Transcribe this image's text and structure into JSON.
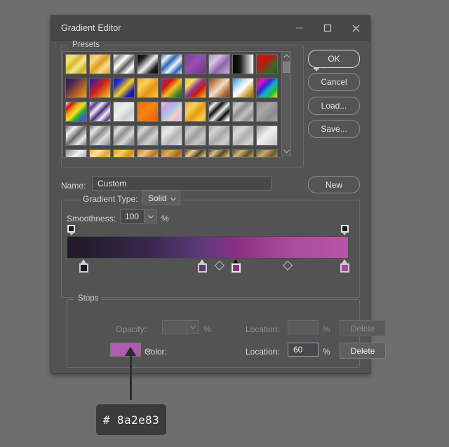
{
  "window": {
    "title": "Gradient Editor",
    "controls": [
      {
        "name": "minimize",
        "glyph": "minimize-icon"
      },
      {
        "name": "maximize",
        "glyph": "maximize-icon"
      },
      {
        "name": "close",
        "glyph": "close-icon"
      }
    ]
  },
  "presets": {
    "label": "Presets",
    "gear_icon": "gear-icon",
    "scrollbar": {
      "up": "chevron-up-icon",
      "down": "chevron-down-icon"
    },
    "swatches": [
      "linear-gradient(135deg,#e8d24a 0%,#f3e27a 22%,#d8b731 42%,#f5e98e 60%,#cfae2c 80%,#e6d456 100%)",
      "linear-gradient(135deg,#f0b93a 0%,#f7d684 24%,#e09b1c 48%,#f8dd92 70%,#dd9a1d 100%)",
      "linear-gradient(135deg,#ffffff 0%,#8d8d8d 18%,#ffffff 38%,#5e5e5e 58%,#ffffff 78%,#7a7a7a 100%)",
      "linear-gradient(135deg,#050505 0%,#1c1c1c 22%,#f2f2f2 52%,#202020 78%,#070707 100%)",
      "linear-gradient(135deg,#2f6fc4 0%,#e9eef6 20%,#2c66b8 40%,#eef2f8 60%,#2a63b4 80%,#e8eef6 100%)",
      "linear-gradient(135deg,#7a3c96 0%,#9a4fb4 45%,#6d3187 100%)",
      "linear-gradient(135deg,#b08ac8 0%,#d8c4e4 30%,#8e63ab 60%,#cdb5de 100%)",
      "linear-gradient(90deg,#000000 0%,#1a1a1a 35%,#ffffff 100%)",
      "linear-gradient(135deg,#d01313 0%,#b81b12 40%,#2f6b2c 75%,#1d5b22 100%)",
      "linear-gradient(135deg,#2b1b4d 0%,#4a2a55 28%,#b05d1e 62%,#f0a022 100%)",
      "linear-gradient(135deg,#1a1ab5 0%,#d01f1f 48%,#f2d21c 100%)",
      "linear-gradient(135deg,#1a1ab5 0%,#2e2ec0 22%,#f2d21c 52%,#1a1ab5 80%,#1313a0 100%)",
      "linear-gradient(135deg,#f0a81e 0%,#f7d25c 30%,#e89210 62%,#f6cc52 100%)",
      "linear-gradient(135deg,#7a3c96 0%,#d01313 30%,#f2c21c 55%,#2f7a2c 85%,#1d5b22 100%)",
      "linear-gradient(135deg,#f2c21c 0%,#f6dc6a 25%,#8a3b8a 48%,#d01313 66%,#f2c21c 100%)",
      "linear-gradient(135deg,#7a4a28 0%,#c98f5e 25%,#f3ddc9 50%,#b47a48 75%,#6e4022 100%)",
      "linear-gradient(135deg,#2f8fe0 0%,#bfe0f5 32%,#ffffff 50%,#c99a2a 78%,#8a6412 100%)",
      "linear-gradient(135deg,#d01313 0%,#e012c0 20%,#2a2ad0 40%,#16b0d0 58%,#22c02a 78%,#f2e21c 100%)",
      "linear-gradient(135deg,#e8e8e8 0%,#d01313 18%,#f2a21c 34%,#f2e21c 50%,#2ab02a 66%,#2a6ad0 82%,#a02ad0 100%)",
      "linear-gradient(135deg,#f0f0f0 0%,#5a3a8a 18%,#efeff5 34%,#4a2e7a 52%,#f0f0f5 70%,#5a3a8a 88%,#efeff5 100%)",
      "linear-gradient(135deg,#d9d9d9 0%,#eeeeee 40%,#cfcfcf 70%,#e8e8e8 100%)",
      "linear-gradient(135deg,#f06a08 0%,#f58416 45%,#e85f04 100%)",
      "linear-gradient(135deg,#f0c8d8 0%,#c8a0e0 22%,#a8c0ee 44%,#f0d0c0 66%,#e0b8e8 88%,#c8d8f0 100%)",
      "linear-gradient(135deg,#f0a81e 0%,#f8d35e 28%,#e89a10 56%,#f7cf58 84%,#eca11a 100%)",
      "linear-gradient(135deg,#080808 0%,#f2f2f2 18%,#0c0c0c 36%,#eeeeee 54%,#0a0a0a 72%,#f0f0f0 90%)",
      "linear-gradient(135deg,#9a9a9a 0%,#c8c8c8 20%,#8e8e8e 40%,#c2c2c2 60%,#909090 80%,#c6c6c6 100%)",
      "linear-gradient(135deg,#8c8c8c 0%,#a8a8a8 35%,#8a8a8a 70%,#a4a4a4 100%)",
      "linear-gradient(135deg,#6f6f6f 0%,#eeeeee 25%,#6a6a6a 50%,#e8e8e8 75%,#767676 100%)",
      "linear-gradient(135deg,#7a7a7a 0%,#e4e4e4 22%,#8a8a8a 44%,#dcdcdc 66%,#848484 100%)",
      "linear-gradient(135deg,#848484 0%,#dedede 20%,#8e8e8e 42%,#d8d8d8 64%,#8a8a8a 88%)",
      "linear-gradient(135deg,#8e8e8e 0%,#d6d6d6 22%,#969696 44%,#d2d2d2 68%,#909090 100%)",
      "linear-gradient(135deg,#c8c8c8 0%,#e8e8e8 30%,#b4b4b4 60%,#dadada 100%)",
      "linear-gradient(135deg,#a4a4a4 0%,#cacaca 24%,#9e9e9e 48%,#c6c6c6 72%,#a0a0a0 100%)",
      "linear-gradient(135deg,#aeaeae 0%,#d2d2d2 26%,#a8a8a8 52%,#cecece 78%,#ababab 100%)",
      "linear-gradient(135deg,#b4b4b4 0%,#d8d8d8 28%,#aeaeae 56%,#d4d4d4 84%,#b0b0b0 100%)",
      "linear-gradient(135deg,#9a9a9a 0%,#f0f0f0 45%,#c4c4c4 100%)",
      "linear-gradient(135deg,#8a8a8a 0%,#f2f2f2 40%,#9e9e9e 75%,#e2e2e2 100%)",
      "linear-gradient(135deg,#f2b33a 0%,#fbe1a0 26%,#eda222 52%,#f9dc96 78%,#efac2e 100%)",
      "linear-gradient(135deg,#eda01a 0%,#f9cf68 26%,#e08e0c 52%,#f7c85c 78%,#e8950f 100%)",
      "linear-gradient(135deg,#c6822c 0%,#edc186 26%,#b8742a 52%,#e7b77c 78%,#bf7b2a 100%)",
      "linear-gradient(135deg,#b8761e 0%,#e0ab5e 26%,#a96b1a 52%,#d9a356 78%,#b06f1c 100%)",
      "linear-gradient(135deg,#4a3a1e 0%,#e8d08a 22%,#564224 44%,#e2c882 66%,#4e3c20 88%)",
      "linear-gradient(135deg,#554220 0%,#dcc07a 20%,#5c4724 42%,#d6b972 64%,#584423 86%)",
      "linear-gradient(135deg,#5e4a26 0%,#d4b56e 24%,#63502a 48%,#cfb068 72%,#604c28 100%)",
      "linear-gradient(135deg,#6a5430 0%,#cbab64 26%,#6e5832 52%,#c6a55e 78%,#6c5631 100%)"
    ]
  },
  "buttons": {
    "ok": "OK",
    "cancel": "Cancel",
    "load": "Load...",
    "save": "Save...",
    "new": "New"
  },
  "name_row": {
    "label": "Name:",
    "value": "Custom"
  },
  "gradient": {
    "type_label": "Gradient Type:",
    "type_value": "Solid",
    "smoothness_label": "Smoothness:",
    "smoothness_value": "100",
    "percent": "%",
    "bar_css": "linear-gradient(90deg,#211a28 0%,#241c2c 6%,#3a2850 30%,#5c3b7c 48%,#8a2e83 60%,#a84a9a 78%,#b855a8 100%)",
    "opacity_stops": [
      {
        "position": 1.5,
        "color": "#1a1a1a"
      },
      {
        "position": 98.5,
        "color": "#1a1a1a"
      }
    ],
    "color_stops": [
      {
        "position": 6,
        "color": "#1c1726",
        "selected": false
      },
      {
        "position": 48,
        "color": "#5c3b7c",
        "selected": false
      },
      {
        "position": 60,
        "color": "#8a2e83",
        "selected": true
      },
      {
        "position": 98.5,
        "color": "#a9459d",
        "selected": false
      }
    ],
    "midpoints": [
      54,
      78
    ]
  },
  "stops": {
    "label": "Stops",
    "opacity_label": "Opacity:",
    "opacity_value": "",
    "opacity_percent": "%",
    "opacity_location_label": "Location:",
    "opacity_location_value": "",
    "opacity_location_percent": "%",
    "opacity_delete": "Delete",
    "color_label": "Color:",
    "color_value": "#b05ab0",
    "color_location_label": "Location:",
    "color_location_value": "60",
    "color_location_percent": "%",
    "color_delete": "Delete"
  },
  "callout": {
    "text": "# 8a2e83",
    "arrow_icon": "arrow-up-icon"
  }
}
